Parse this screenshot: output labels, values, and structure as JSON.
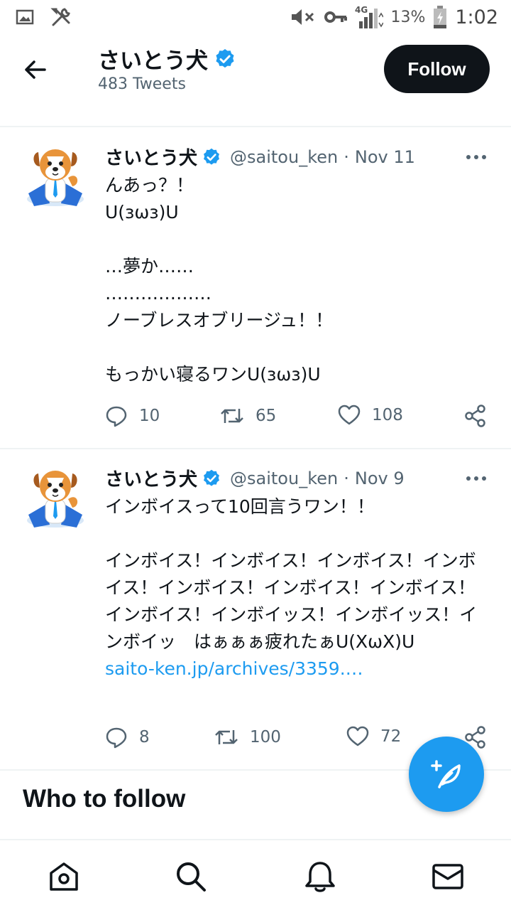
{
  "status_bar": {
    "battery_percent": "13%",
    "time": "1:02",
    "network": "4G"
  },
  "header": {
    "back_icon": "arrow-left-icon",
    "profile_name": "さいとう犬",
    "tweet_count": "483 Tweets",
    "follow_label": "Follow"
  },
  "tweets": [
    {
      "name": "さいとう犬",
      "handle": "@saitou_ken",
      "dot": "·",
      "date": "Nov 11",
      "text": "んあっ？！\nU(ɜωɜ)U\n\n…夢か……\n………………\nノーブレスオブリージュ！！\n\nもっかい寝るワンU(ɜωɜ)U",
      "link": "",
      "replies": "10",
      "retweets": "65",
      "likes": "108"
    },
    {
      "name": "さいとう犬",
      "handle": "@saitou_ken",
      "dot": "·",
      "date": "Nov 9",
      "text": "インボイスって10回言うワン！！\n\nインボイス！インボイス！インボイス！インボイス！インボイス！インボイス！インボイス！インボイス！インボイッス！インボイッス！インボイッ　はぁぁぁ疲れたぁU(XωX)U\n",
      "link": "saito-ken.jp/archives/3359.…",
      "replies": "8",
      "retweets": "100",
      "likes": "72"
    }
  ],
  "who_to_follow": "Who to follow",
  "colors": {
    "accent": "#1d9bf0",
    "text": "#0f1419",
    "muted": "#536471",
    "follow_button": "#0f1419"
  },
  "bottom_nav": [
    "home-icon",
    "search-icon",
    "notifications-bell-icon",
    "messages-envelope-icon"
  ]
}
